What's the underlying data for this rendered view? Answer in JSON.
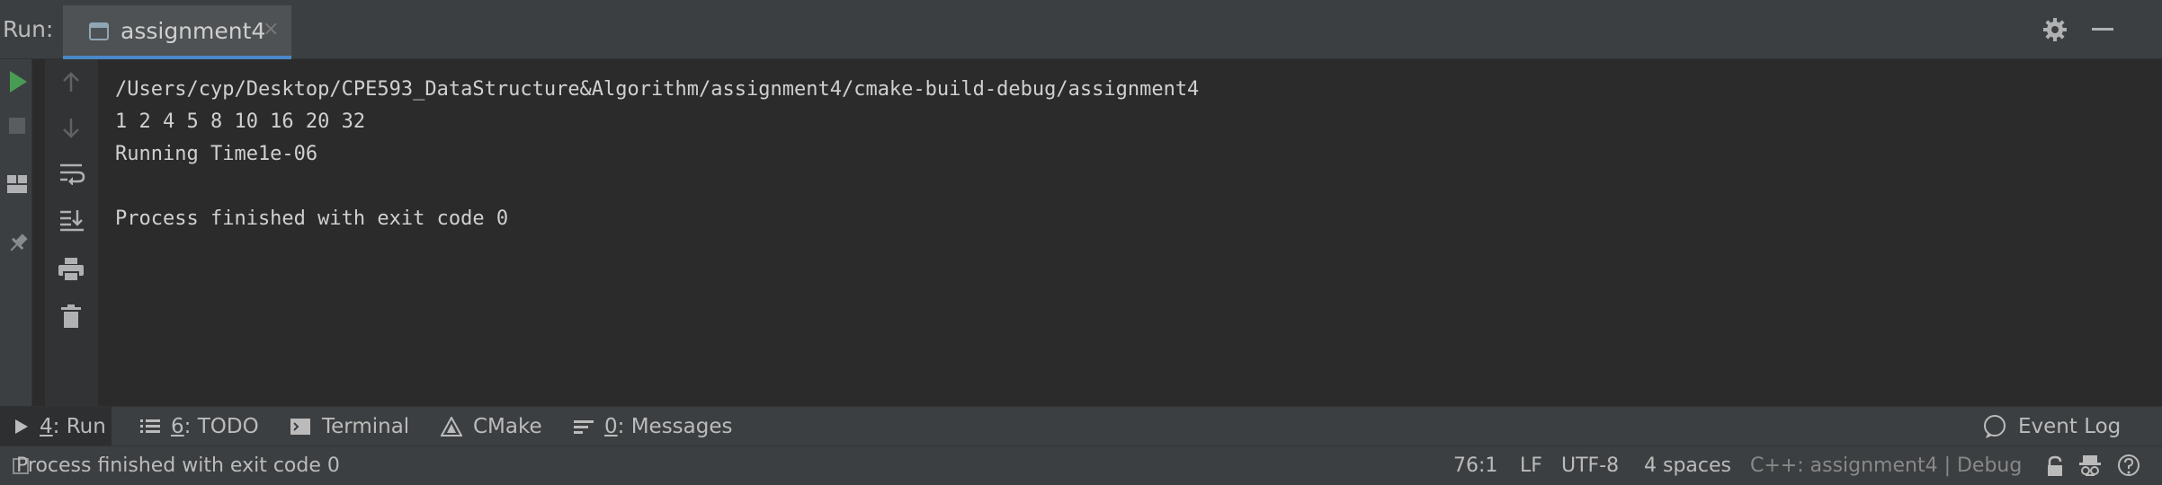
{
  "header": {
    "run_label": "Run:",
    "tab_label": "assignment4",
    "tab_close": "×"
  },
  "console": {
    "lines": [
      "/Users/cyp/Desktop/CPE593_DataStructure&Algorithm/assignment4/cmake-build-debug/assignment4",
      "1 2 4 5 8 10 16 20 32",
      "Running Time1e-06",
      "",
      "Process finished with exit code 0"
    ]
  },
  "tool_tabs": {
    "run": {
      "num": "4",
      "rest": ": Run"
    },
    "todo": {
      "num": "6",
      "rest": ": TODO"
    },
    "terminal": "Terminal",
    "cmake": "CMake",
    "messages": {
      "num": "0",
      "rest": ": Messages"
    },
    "event_log": "Event Log"
  },
  "status_bar": {
    "message": "Process finished with exit code 0",
    "position": "76:1",
    "line_sep": "LF",
    "encoding": "UTF-8",
    "indent": "4 spaces",
    "context": "C++: assignment4 | Debug"
  },
  "icons": {
    "run": "play-icon",
    "stop": "stop-icon",
    "layout": "layout-icon",
    "pin": "pin-icon",
    "up": "arrow-up-icon",
    "down": "arrow-down-icon",
    "wrap": "soft-wrap-icon",
    "scroll": "scroll-to-end-icon",
    "print": "print-icon",
    "trash": "trash-icon",
    "gear": "gear-icon",
    "minimize": "minimize-icon"
  },
  "colors": {
    "run_green": "#499c54",
    "accent_blue": "#4a88c7",
    "background": "#2b2b2b",
    "panel": "#3c3f41"
  }
}
